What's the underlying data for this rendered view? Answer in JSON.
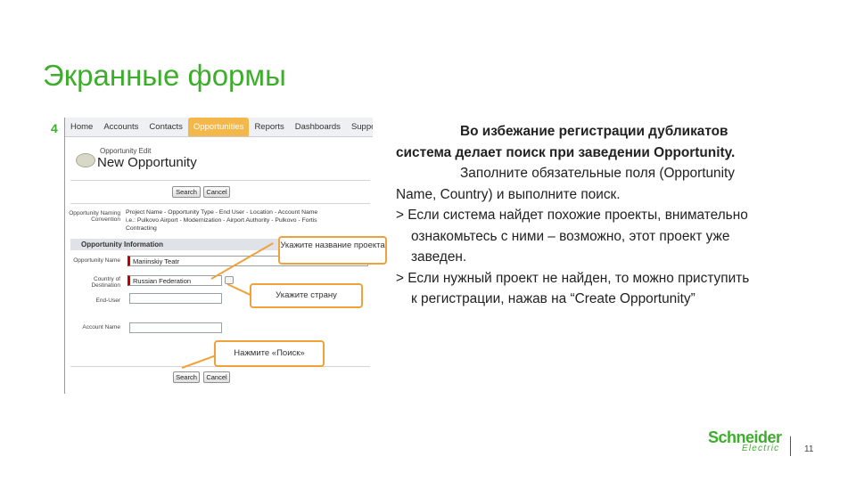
{
  "slide": {
    "title": "Экранные формы",
    "step_number": "4",
    "page_number": "11"
  },
  "screenshot": {
    "tabs": [
      "Home",
      "Accounts",
      "Contacts",
      "Opportunities",
      "Reports",
      "Dashboards",
      "Suppo"
    ],
    "active_tab": "Opportunities",
    "subtitle": "Opportunity Edit",
    "page_title": "New Opportunity",
    "search_button": "Search",
    "cancel_button": "Cancel",
    "naming_label": "Opportunity Naming Convention",
    "naming_line1": "Project Name - Opportunity Type - End User - Location - Account Name",
    "naming_line2": "i.e.: Pulkovo Airport - Modernization - Airport Authority - Pulkovo - Fortis",
    "naming_line3": "Contracting",
    "section_title": "Opportunity Information",
    "field_opp_name_label": "Opportunity Name",
    "field_opp_name_value": "Mariinskiy Teatr",
    "field_country_label": "Country of Destination",
    "field_country_value": "Russian Federation",
    "field_end_user_label": "End-User",
    "field_account_label": "Account Name"
  },
  "callouts": {
    "name": "Укажите название проекта",
    "country": "Укажите страну",
    "search": "Нажмите «Поиск»"
  },
  "body": {
    "line1": "Во избежание регистрации дубликатов",
    "line2": "система делает поиск при заведении Opportunity.",
    "line3": "Заполните обязательные поля (Opportunity",
    "line4": "Name, Country) и выполните поиск.",
    "bullet1_a": "> Если система найдет похожие проекты, внимательно",
    "bullet1_b": "ознакомьтесь с ними – возможно, этот проект уже",
    "bullet1_c": "заведен.",
    "bullet2_a": "> Если нужный проект не найден, то можно приступить",
    "bullet2_b": "к регистрации, нажав на “Create Opportunity”"
  },
  "logo": {
    "name": "Schneider",
    "sub": "Electric"
  },
  "colors": {
    "accent_green": "#3dae2b",
    "callout_orange": "#f0a23a",
    "active_tab": "#f3b74a",
    "required_red": "#c00000"
  }
}
